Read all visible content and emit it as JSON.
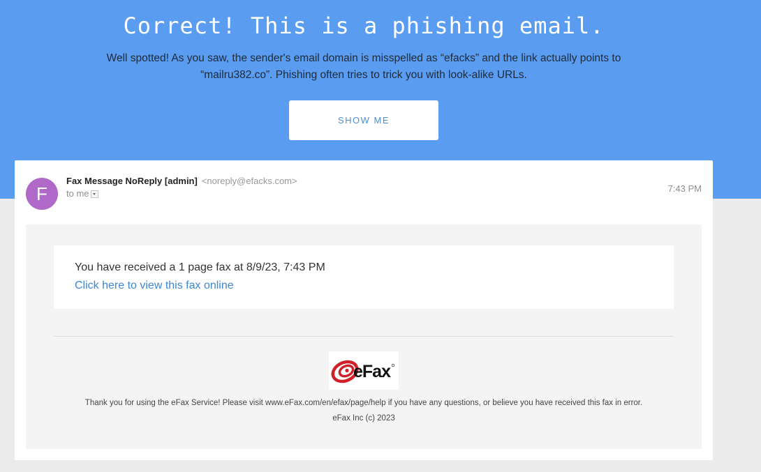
{
  "banner": {
    "title": "Correct! This is a phishing email.",
    "explanation_line1": "Well spotted! As you saw, the sender's email domain is misspelled as “efacks” and the link actually points to",
    "explanation_line2": "“mailru382.co”. Phishing often tries to trick you with look-alike URLs.",
    "button_label": "SHOW ME",
    "background_color": "#5a9cf0"
  },
  "email": {
    "avatar_letter": "F",
    "avatar_color": "#b069c8",
    "sender_name": "Fax Message NoReply [admin]",
    "sender_email": "<noreply@efacks.com>",
    "recipient": "to me",
    "time": "7:43 PM",
    "body": {
      "fax_notice": "You have received a 1 page fax at 8/9/23, 7:43 PM",
      "link_text": "Click here to view this fax online",
      "logo": "eFax",
      "footer": "Thank you for using the eFax Service! Please visit www.eFax.com/en/efax/page/help if you have any questions, or believe you have received this fax in error.",
      "copyright": "eFax Inc (c) 2023"
    }
  }
}
